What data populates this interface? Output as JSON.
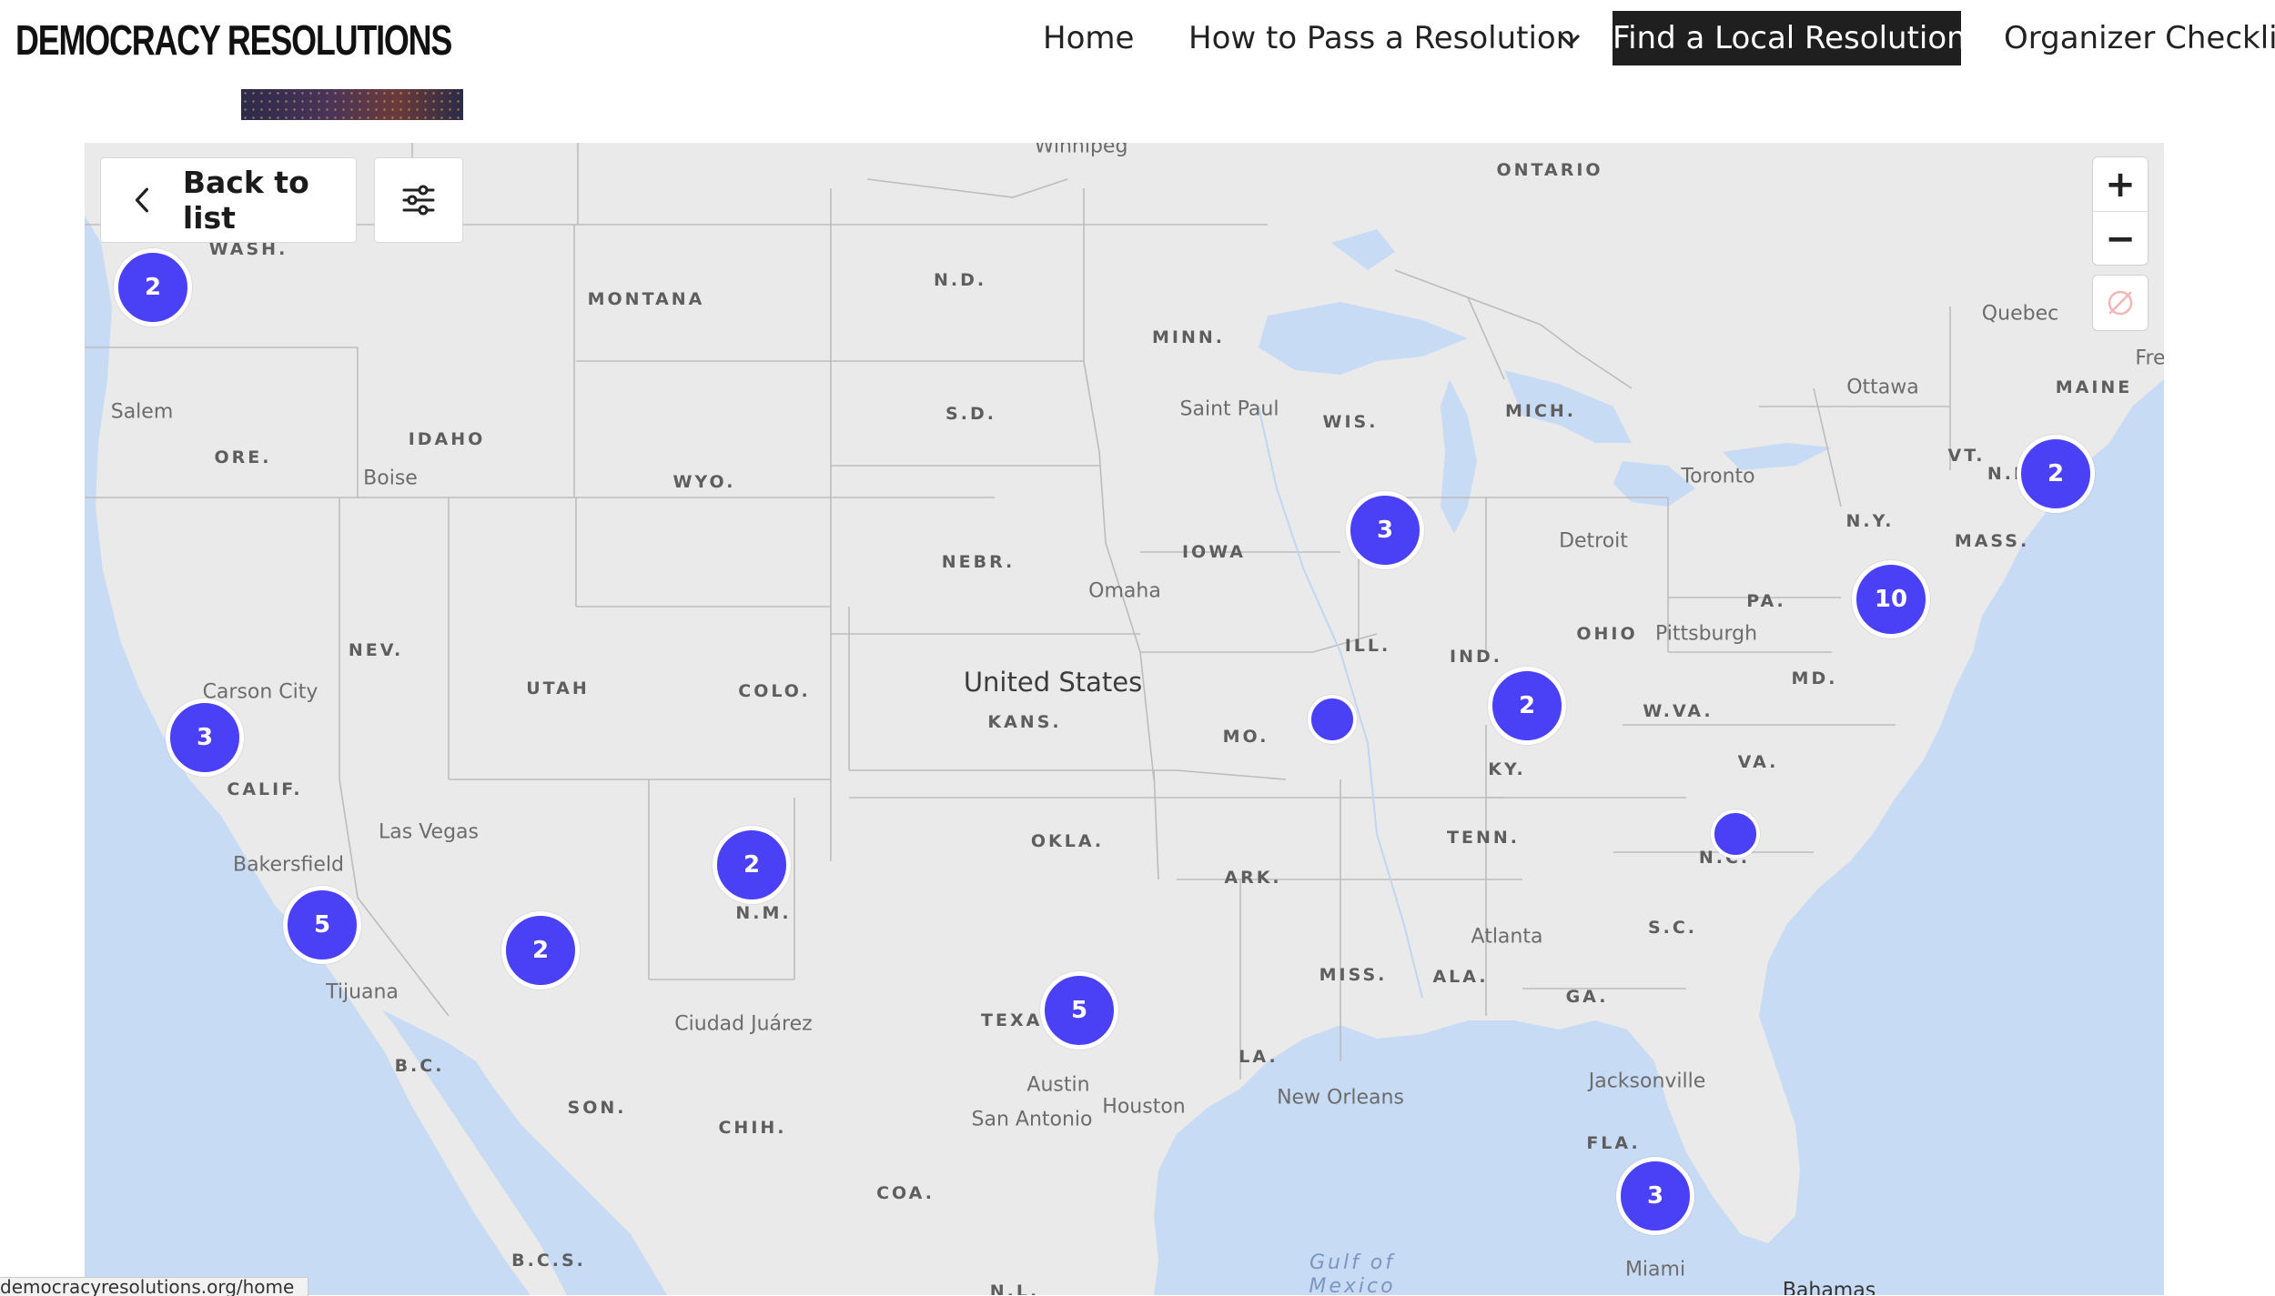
{
  "header": {
    "site_title": "DEMOCRACY RESOLUTIONS",
    "nav": {
      "home": "Home",
      "how_to": "How to Pass a Resolution",
      "find_local": "Find a Local Resolution",
      "checklist": "Organizer Checklist"
    }
  },
  "map": {
    "back_label": "Back to list",
    "zoom_in": "+",
    "zoom_out": "−",
    "country_label": "United States",
    "water_labels": {
      "gulf": "Gulf of Mexico"
    },
    "regions": {
      "wash": "WASH.",
      "montana": "MONTANA",
      "nd": "N.D.",
      "minn": "MINN.",
      "ontario": "ONTARIO",
      "idaho": "IDAHO",
      "ore": "ORE.",
      "wyo": "WYO.",
      "sd": "S.D.",
      "wis": "WIS.",
      "mich": "MICH.",
      "maine": "MAINE",
      "vt": "VT.",
      "nh": "N.H.",
      "ny": "N.Y.",
      "mass": "MASS.",
      "nebr": "NEBR.",
      "iowa": "IOWA",
      "pa": "PA.",
      "ohio": "OHIO",
      "ill": "ILL.",
      "ind": "IND.",
      "nev": "NEV.",
      "utah": "UTAH",
      "colo": "COLO.",
      "kans": "KANS.",
      "mo": "MO.",
      "md": "MD.",
      "wva": "W.VA.",
      "va": "VA.",
      "ky": "KY.",
      "calif": "CALIF.",
      "okla": "OKLA.",
      "tenn": "TENN.",
      "nc": "N.C.",
      "ark": "ARK.",
      "nm": "N.M.",
      "sc": "S.C.",
      "miss": "MISS.",
      "ala": "ALA.",
      "ga": "GA.",
      "texas": "TEXAS",
      "la": "LA.",
      "bc": "B.C.",
      "son": "SON.",
      "chih": "CHIH.",
      "coa": "COA.",
      "fla": "FLA.",
      "bcs": "B.C.S.",
      "nl": "N.L."
    },
    "cities": {
      "winnipeg": "Winnipeg",
      "salem": "Salem",
      "boise": "Boise",
      "saint_paul": "Saint Paul",
      "quebec": "Quebec",
      "ottawa": "Ottawa",
      "fre": "Fre",
      "toronto": "Toronto",
      "detroit": "Detroit",
      "omaha": "Omaha",
      "pittsburgh": "Pittsburgh",
      "carson_city": "Carson City",
      "las_vegas": "Las Vegas",
      "bakersfield": "Bakersfield",
      "tijuana": "Tijuana",
      "atlanta": "Atlanta",
      "ciudad_juarez": "Ciudad Juárez",
      "austin": "Austin",
      "san_antonio": "San Antonio",
      "houston": "Houston",
      "new_orleans": "New Orleans",
      "jacksonville": "Jacksonville",
      "miami": "Miami",
      "bahamas": "Bahamas"
    },
    "clusters": [
      {
        "id": "washington",
        "count": "2"
      },
      {
        "id": "wisconsin",
        "count": "3"
      },
      {
        "id": "new-england",
        "count": "2"
      },
      {
        "id": "pennsylvania",
        "count": "10"
      },
      {
        "id": "northern-california",
        "count": "3"
      },
      {
        "id": "missouri",
        "count": ""
      },
      {
        "id": "kentucky",
        "count": "2"
      },
      {
        "id": "north-carolina",
        "count": ""
      },
      {
        "id": "new-mexico",
        "count": "2"
      },
      {
        "id": "southern-california",
        "count": "5"
      },
      {
        "id": "arizona",
        "count": "2"
      },
      {
        "id": "texas",
        "count": "5"
      },
      {
        "id": "florida",
        "count": "3"
      }
    ],
    "colors": {
      "cluster": "#4a40f5",
      "water": "#c7dbf5",
      "land": "#eaeaea",
      "border": "#b9b9b9"
    }
  },
  "status_bar": {
    "url": "democracyresolutions.org/home"
  }
}
